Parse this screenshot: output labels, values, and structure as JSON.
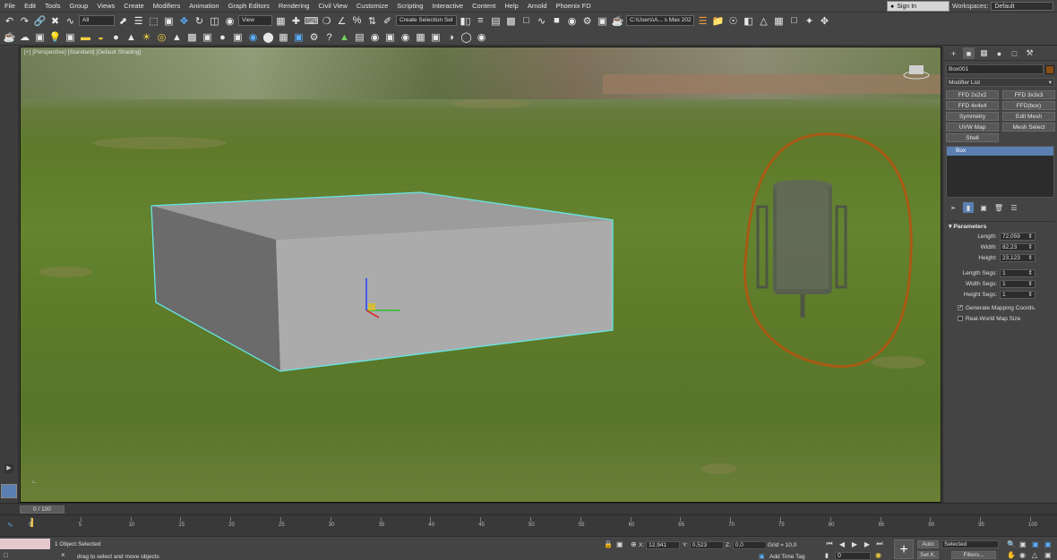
{
  "menu": {
    "items": [
      "File",
      "Edit",
      "Tools",
      "Group",
      "Views",
      "Create",
      "Modifiers",
      "Animation",
      "Graph Editors",
      "Rendering",
      "Civil View",
      "Customize",
      "Scripting",
      "Interactive",
      "Content",
      "Help",
      "Arnold",
      "Phoenix FD"
    ],
    "sign_in": "Sign In",
    "workspaces_label": "Workspaces:",
    "workspaces_value": "Default"
  },
  "toolbar": {
    "filter_value": "All",
    "ref_coord_value": "View",
    "selection_set_value": "Create Selection Set",
    "project_path": "C:\\Users\\A... s Max 202"
  },
  "viewport": {
    "label": "[+] [Perspective] [Standard] [Default Shading]",
    "accent_color": "#66e5e5",
    "annotation_color": "#a85a14"
  },
  "command_panel": {
    "object_name": "Box001",
    "modifier_list_label": "Modifier List",
    "modifier_buttons": [
      "FFD 2x2x2",
      "FFD 3x3x3",
      "FFD 4x4x4",
      "FFD(box)",
      "Symmetry",
      "Edit Mesh",
      "UVW Map",
      "Mesh Select",
      "Shell"
    ],
    "stack_item": "Box",
    "params_title": "Parameters",
    "length_label": "Length:",
    "length_value": "72,059",
    "width_label": "Width:",
    "width_value": "82,23",
    "height_label": "Height:",
    "height_value": "23,123",
    "length_segs_label": "Length Segs:",
    "length_segs_value": "1",
    "width_segs_label": "Width Segs:",
    "width_segs_value": "1",
    "height_segs_label": "Height Segs:",
    "height_segs_value": "1",
    "gen_mapping_label": "Generate Mapping Coords.",
    "real_world_label": "Real-World Map Size"
  },
  "timeline": {
    "frame_counter": "0 / 100",
    "ticks": [
      "0",
      "5",
      "10",
      "15",
      "20",
      "25",
      "30",
      "35",
      "40",
      "45",
      "50",
      "55",
      "60",
      "65",
      "70",
      "75",
      "80",
      "85",
      "90",
      "95",
      "100"
    ]
  },
  "status": {
    "selected": "1 Object Selected",
    "prompt": "drag to select and move objects",
    "x_label": "X:",
    "x_value": "12,941",
    "y_label": "Y:",
    "y_value": "0,523",
    "z_label": "Z:",
    "z_value": "0,0",
    "grid": "Grid = 10,0",
    "add_time_tag": "Add Time Tag",
    "auto": "Auto",
    "set_key": "Set K.",
    "selected_dropdown": "Selected",
    "filters": "Filters...",
    "current_frame": "0"
  }
}
